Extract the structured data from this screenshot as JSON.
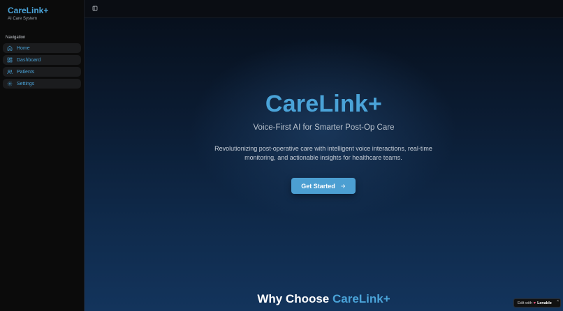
{
  "sidebar": {
    "brand_title": "CareLink+",
    "brand_subtitle": "AI Care System",
    "nav_heading": "Navigation",
    "items": [
      {
        "label": "Home",
        "icon": "home-icon"
      },
      {
        "label": "Dashboard",
        "icon": "dashboard-icon"
      },
      {
        "label": "Patients",
        "icon": "users-icon"
      },
      {
        "label": "Settings",
        "icon": "gear-icon"
      }
    ]
  },
  "topbar": {
    "toggle_icon": "sidebar-toggle-icon"
  },
  "hero": {
    "title": "CareLink+",
    "subtitle": "Voice-First AI for Smarter Post-Op Care",
    "description_line1": "Revolutionizing post-operative care with intelligent voice interactions, real-time",
    "description_line2": "monitoring, and actionable insights for healthcare teams.",
    "cta_label": "Get Started",
    "cta_icon": "arrow-right-icon"
  },
  "section": {
    "title_prefix": "Why Choose",
    "title_accent": "CareLink+"
  },
  "badge": {
    "edit_text": "Edit with",
    "brand": "Lovable",
    "close": "×"
  },
  "colors": {
    "accent": "#4aa3d8",
    "cta_background": "#4c9fd2",
    "sidebar_background": "#0b0b0b"
  }
}
